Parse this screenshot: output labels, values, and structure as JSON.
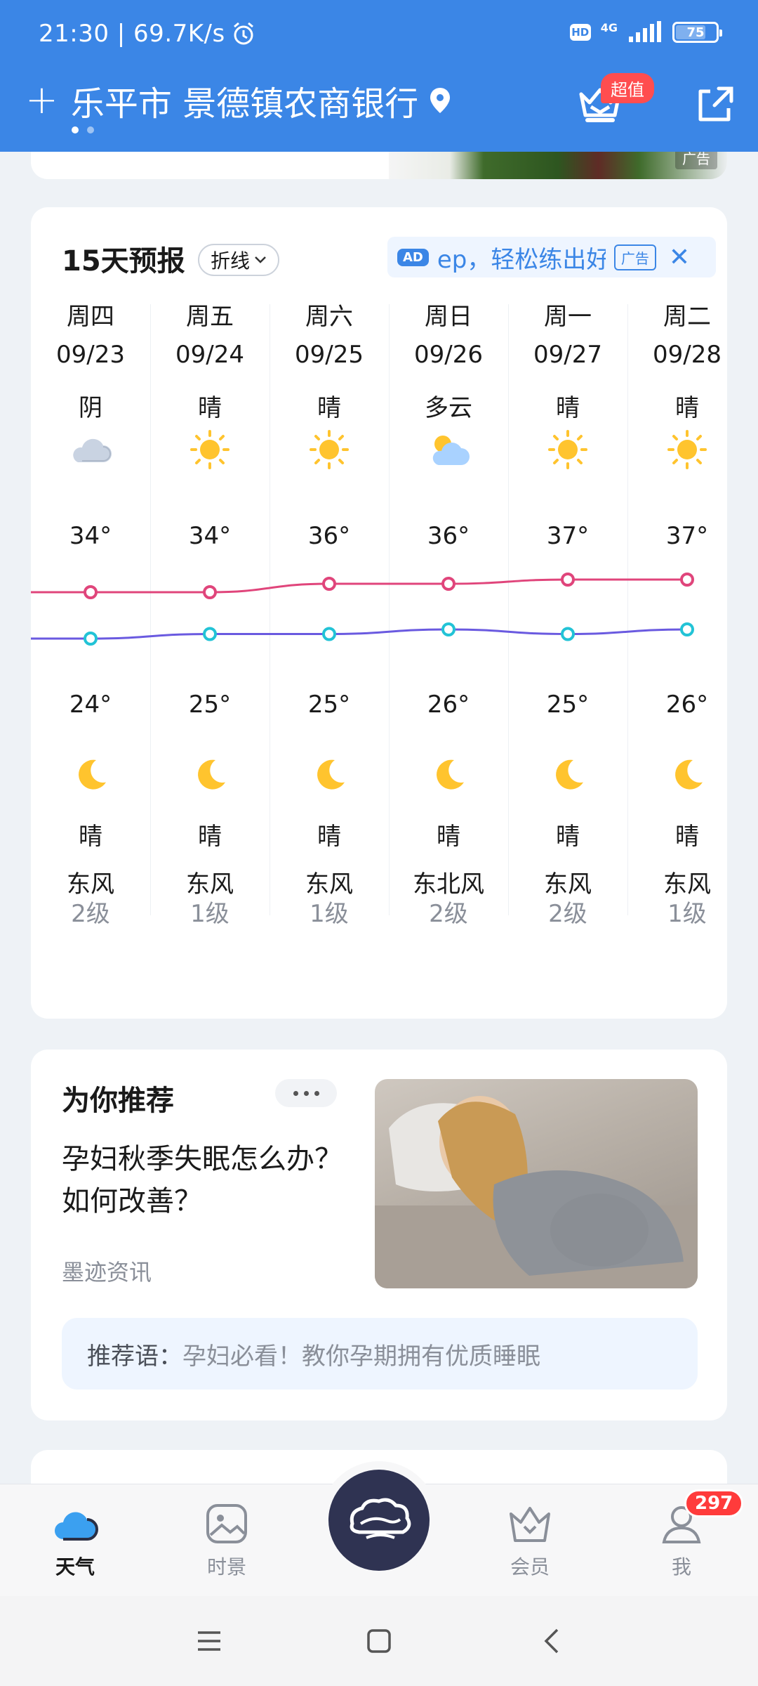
{
  "status_bar": {
    "time_speed": "21:30 | 69.7K/s",
    "hd": "HD",
    "network": "4G",
    "battery": "75"
  },
  "header": {
    "location": "乐平市 景德镇农商银行",
    "vip_badge": "超值"
  },
  "top_card": {
    "ad_tag": "广告"
  },
  "forecast": {
    "title": "15天预报",
    "toggle": "折线",
    "ad": {
      "badge": "AD",
      "text": "ep，轻松练出好",
      "label": "广告",
      "close": "✕"
    },
    "days": [
      {
        "weekday": "周四",
        "date": "09/23",
        "day_cond": "阴",
        "day_icon": "cloud-icon",
        "high": "34°",
        "low": "24°",
        "night_icon": "moon-icon",
        "night_cond": "晴",
        "wind": "东风",
        "level": "2级"
      },
      {
        "weekday": "周五",
        "date": "09/24",
        "day_cond": "晴",
        "day_icon": "sun-icon",
        "high": "34°",
        "low": "25°",
        "night_icon": "moon-icon",
        "night_cond": "晴",
        "wind": "东风",
        "level": "1级"
      },
      {
        "weekday": "周六",
        "date": "09/25",
        "day_cond": "晴",
        "day_icon": "sun-icon",
        "high": "36°",
        "low": "25°",
        "night_icon": "moon-icon",
        "night_cond": "晴",
        "wind": "东风",
        "level": "1级"
      },
      {
        "weekday": "周日",
        "date": "09/26",
        "day_cond": "多云",
        "day_icon": "partly-cloudy-icon",
        "high": "36°",
        "low": "26°",
        "night_icon": "moon-icon",
        "night_cond": "晴",
        "wind": "东北风",
        "level": "2级"
      },
      {
        "weekday": "周一",
        "date": "09/27",
        "day_cond": "晴",
        "day_icon": "sun-icon",
        "high": "37°",
        "low": "25°",
        "night_icon": "moon-icon",
        "night_cond": "晴",
        "wind": "东风",
        "level": "2级"
      },
      {
        "weekday": "周二",
        "date": "09/28",
        "day_cond": "晴",
        "day_icon": "sun-icon",
        "high": "37°",
        "low": "26°",
        "night_icon": "moon-icon",
        "night_cond": "晴",
        "wind": "东风",
        "level": "1级"
      }
    ],
    "high_line_color": "#e0457b",
    "low_line_color": "#6a5ae0",
    "low_point_color": "#22c3d6"
  },
  "chart_data": {
    "type": "line",
    "x": [
      "09/23",
      "09/24",
      "09/25",
      "09/26",
      "09/27",
      "09/28"
    ],
    "series": [
      {
        "values": [
          34,
          34,
          36,
          36,
          37,
          37
        ]
      },
      {
        "values": [
          24,
          25,
          25,
          26,
          25,
          26
        ]
      }
    ]
  },
  "recommend": {
    "title": "为你推荐",
    "headline": "孕妇秋季失眠怎么办？如何改善？",
    "source": "墨迹资讯",
    "quote_label": "推荐语：",
    "quote_text": "孕妇必看！教你孕期拥有优质睡眠"
  },
  "tabbar": {
    "tabs": [
      {
        "label": "天气",
        "icon": "cloud-icon"
      },
      {
        "label": "时景",
        "icon": "image-icon"
      },
      {
        "label": "会员",
        "icon": "crown-icon"
      },
      {
        "label": "我",
        "icon": "user-icon"
      }
    ],
    "badge": "297"
  }
}
